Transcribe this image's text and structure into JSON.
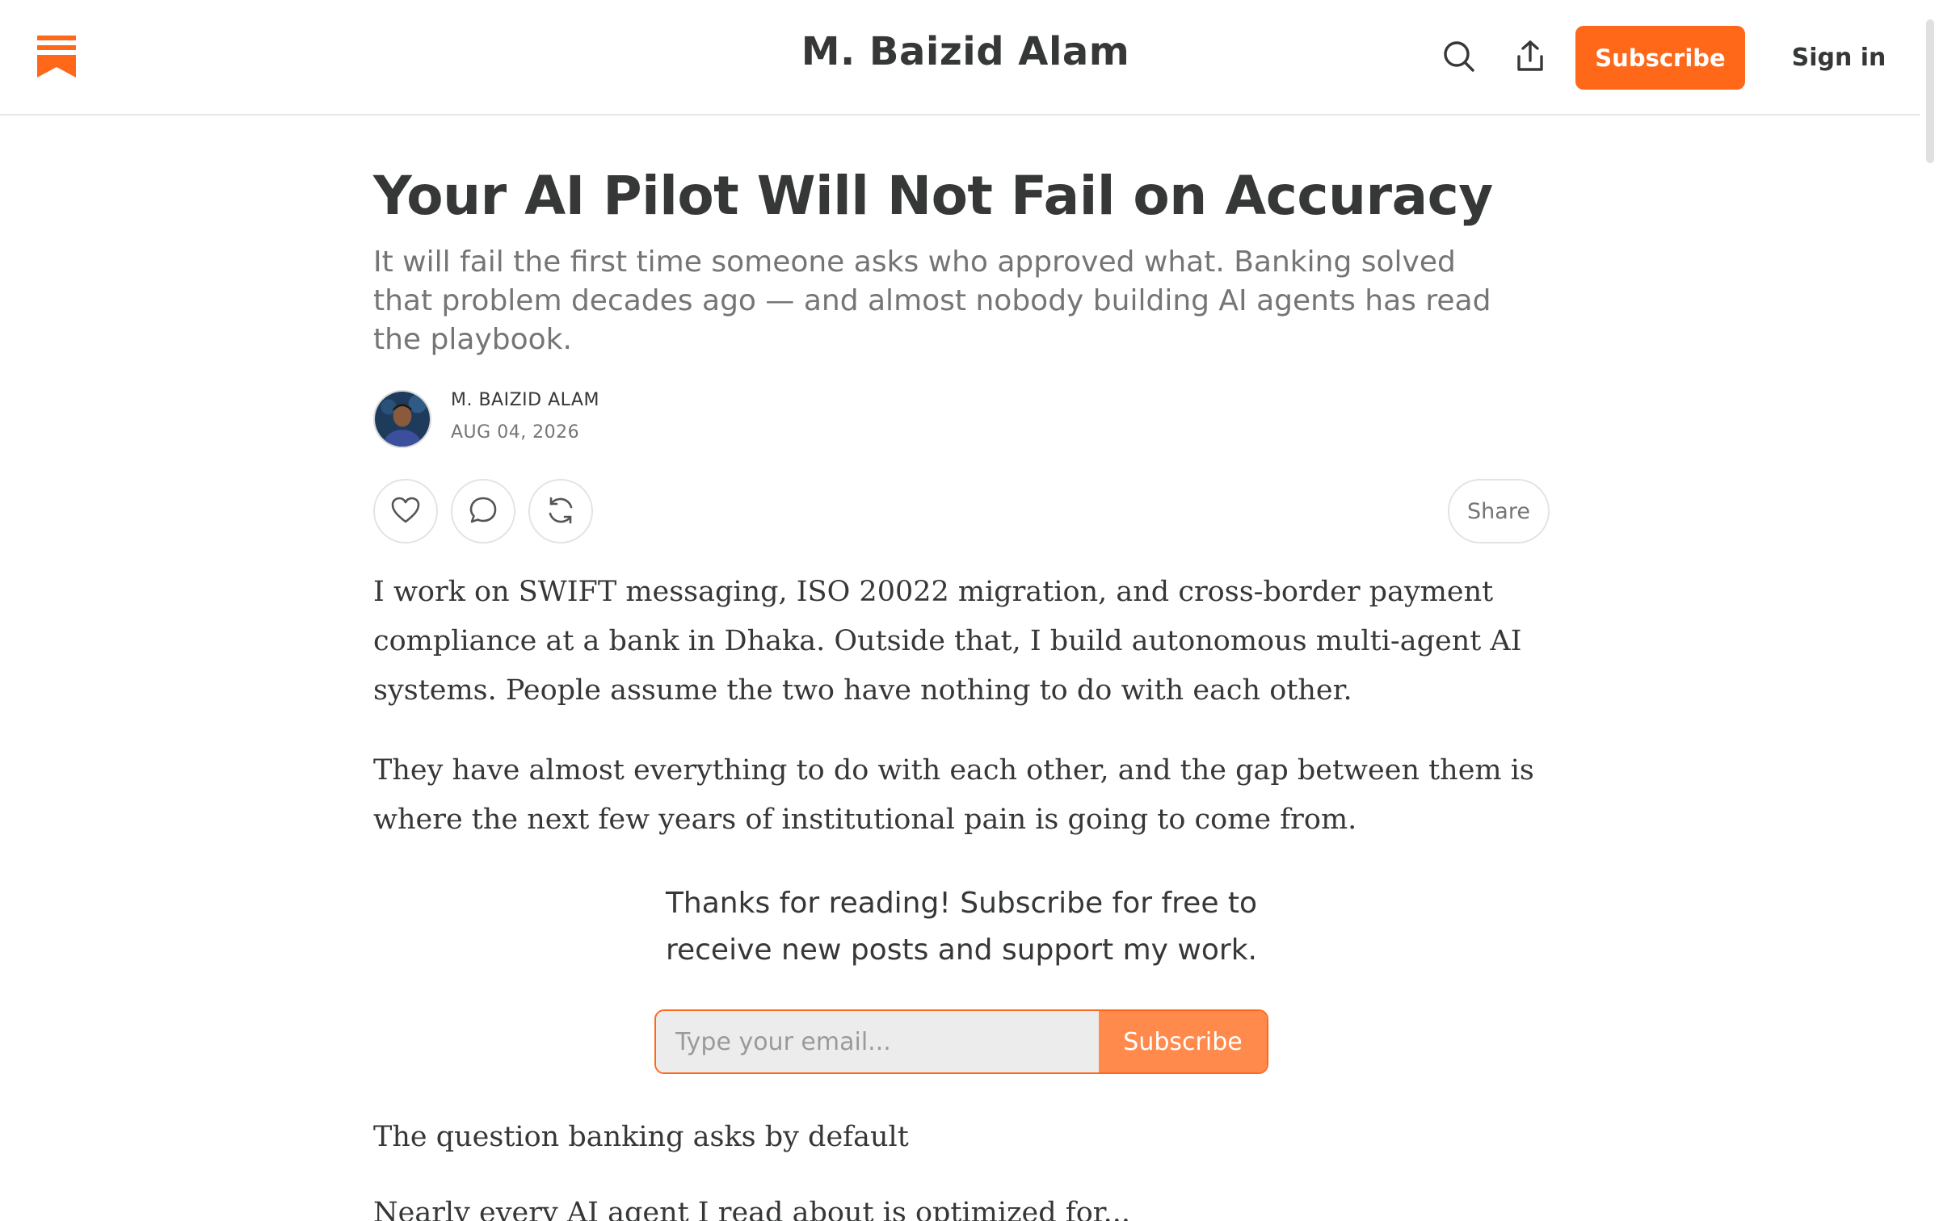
{
  "header": {
    "publication_title": "M. Baizid Alam",
    "subscribe_label": "Subscribe",
    "signin_label": "Sign in",
    "brand_color": "#ff6719",
    "icons": [
      "substack-logo-icon",
      "search-icon",
      "share-upload-icon"
    ]
  },
  "post": {
    "title": "Your AI Pilot Will Not Fail on Accuracy",
    "subtitle": "It will fail the first time someone asks who approved what. Banking solved that problem decades ago — and almost nobody building AI agents has read the playbook.",
    "author": "M. BAIZID ALAM",
    "date": "AUG 04, 2026",
    "share_label": "Share",
    "action_icons": [
      "heart-icon",
      "comment-icon",
      "restack-icon"
    ]
  },
  "body": {
    "paragraph_1": "I work on SWIFT messaging, ISO 20022 migration, and cross-border payment compliance at a bank in Dhaka. Outside that, I build autonomous multi-agent AI systems. People assume the two have nothing to do with each other.",
    "paragraph_2": "They have almost everything to do with each other, and the gap between them is where the next few years of institutional pain is going to come from.",
    "subscribe_cta_line_1": "Thanks for reading! Subscribe for free to",
    "subscribe_cta_line_2": "receive new posts and support my work.",
    "email_placeholder": "Type your email...",
    "email_subscribe_label": "Subscribe",
    "section_heading": "The question banking asks by default",
    "truncated_line": "Nearly every AI agent I read about is optimized for...",
    "text_color": "#363737",
    "muted_color": "#757575"
  }
}
